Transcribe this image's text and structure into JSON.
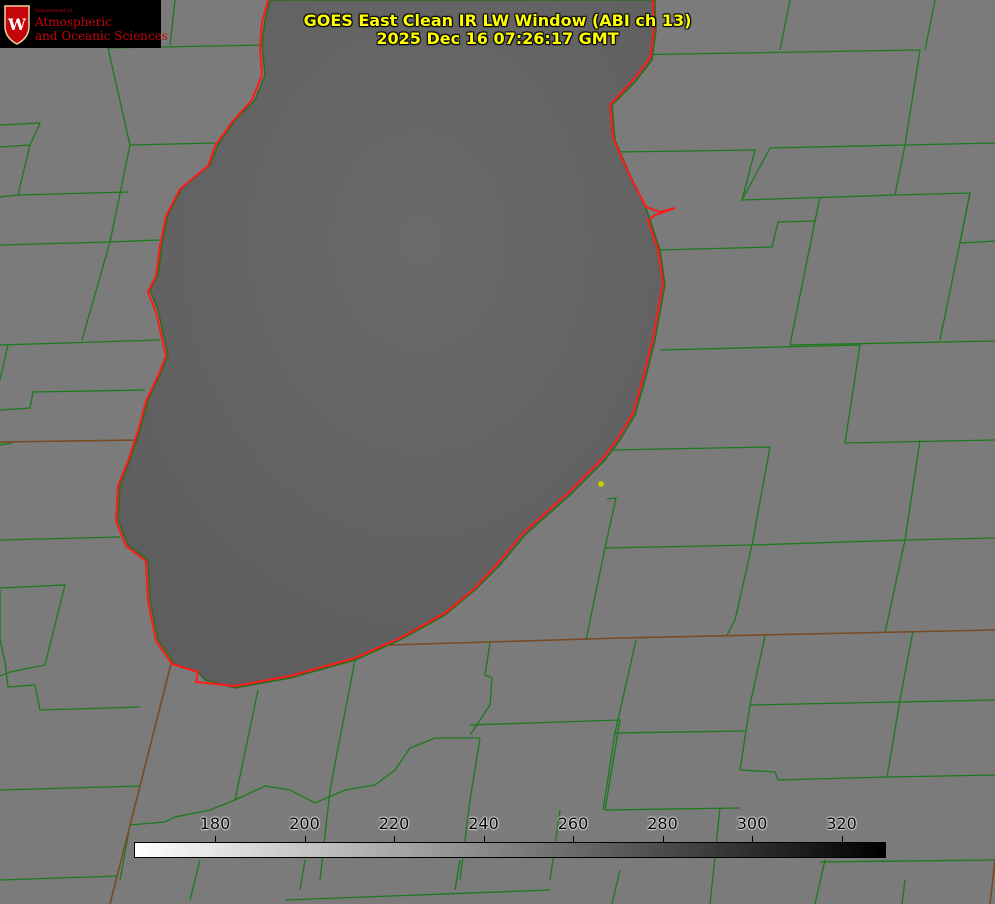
{
  "title": {
    "line1": "GOES East Clean IR LW Window (ABI ch 13)",
    "line2": "2025 Dec 16 07:26:17 GMT"
  },
  "logo": {
    "department": "Department of",
    "line1": "Atmospheric",
    "line2": "and Oceanic Sciences",
    "crest_letter": "W"
  },
  "colorbar": {
    "tick_labels": [
      "180",
      "200",
      "220",
      "240",
      "260",
      "280",
      "300",
      "320"
    ],
    "min_color": "#ffffff",
    "max_color": "#000000"
  },
  "colors": {
    "background_land": "#7a7a7a",
    "lake": "#646464",
    "coastline_red": "#ff1a1a",
    "boundary_green": "#1c7a1c",
    "state_line_brown": "#8a4a1a",
    "marker_yellow": "#c8c800",
    "title_text": "#ffff00"
  }
}
